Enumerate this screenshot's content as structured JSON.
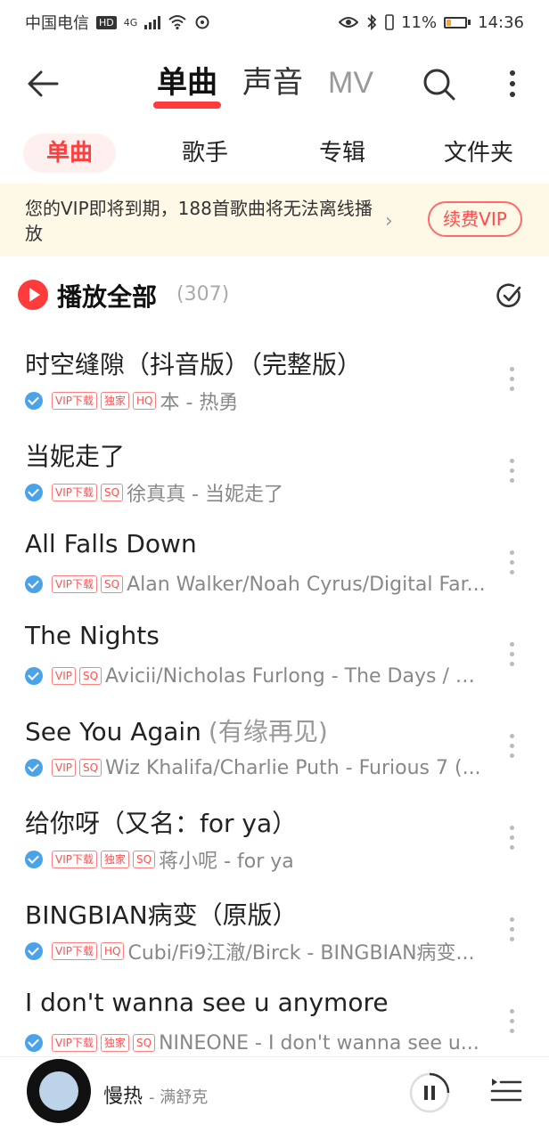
{
  "status_bar": {
    "carrier": "中国电信",
    "hd": "HD",
    "network": "4G",
    "battery": "11%",
    "time": "14:36"
  },
  "nav": {
    "tabs": [
      "单曲",
      "声音",
      "MV"
    ],
    "active_tab": "单曲"
  },
  "subtabs": [
    "单曲",
    "歌手",
    "专辑",
    "文件夹"
  ],
  "vip_banner": {
    "text": "您的VIP即将到期，188首歌曲将无法离线播放",
    "button": "续费VIP"
  },
  "play_all": {
    "label": "播放全部",
    "count": "(307)"
  },
  "songs": [
    {
      "title": "时空缝隙（抖音版）（完整版）",
      "subtitle": "",
      "tags": [
        "VIP下载",
        "独家",
        "HQ"
      ],
      "artist": "本 - 热勇"
    },
    {
      "title": "当妮走了",
      "subtitle": "",
      "tags": [
        "VIP下载",
        "SQ"
      ],
      "artist": "徐真真 - 当妮走了"
    },
    {
      "title": "All Falls Down",
      "subtitle": "",
      "tags": [
        "VIP下载",
        "SQ"
      ],
      "artist": "Alan Walker/Noah Cyrus/Digital Far..."
    },
    {
      "title": "The Nights",
      "subtitle": "",
      "tags": [
        "VIP",
        "SQ"
      ],
      "artist": "Avicii/Nicholas Furlong - The Days / Ni..."
    },
    {
      "title": "See You Again",
      "subtitle": "(有缘再见)",
      "tags": [
        "VIP",
        "SQ"
      ],
      "artist": "Wiz Khalifa/Charlie Puth - Furious 7 (..."
    },
    {
      "title": "给你呀（又名：for ya）",
      "subtitle": "",
      "tags": [
        "VIP下载",
        "独家",
        "SQ"
      ],
      "artist": "蒋小呢 - for ya"
    },
    {
      "title": "BINGBIAN病变（原版）",
      "subtitle": "",
      "tags": [
        "VIP下载",
        "HQ"
      ],
      "artist": "Cubi/Fi9江澈/Birck - BINGBIAN病变..."
    },
    {
      "title": "I don't wanna see u anymore",
      "subtitle": "",
      "tags": [
        "VIP下载",
        "独家",
        "SQ"
      ],
      "artist": "NINEONE - I don't wanna see u..."
    }
  ],
  "player": {
    "title": "慢热",
    "artist": "- 满舒克"
  },
  "colors": {
    "accent": "#ff3b3b",
    "vip_banner_bg": "#fdf9e6",
    "check_blue": "#4aa3e8"
  }
}
